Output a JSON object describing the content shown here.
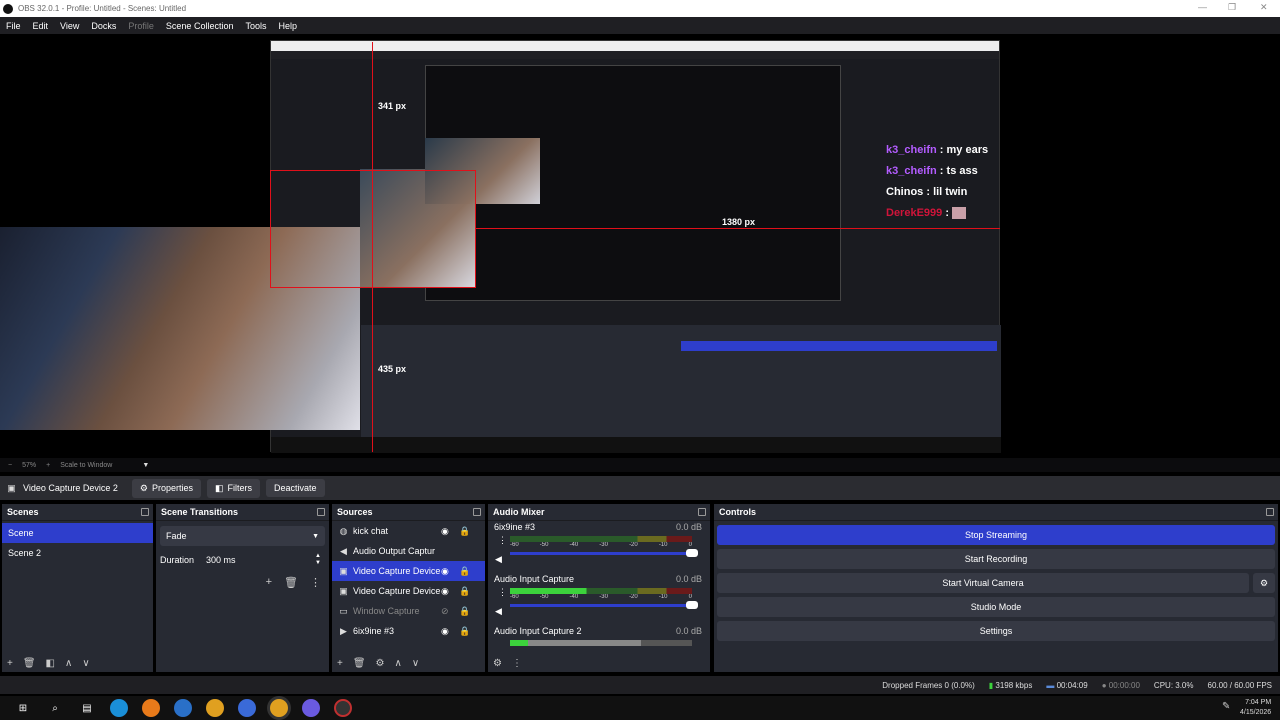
{
  "window": {
    "title": "OBS 32.0.1 - Profile: Untitled - Scenes: Untitled"
  },
  "menu": [
    "File",
    "Edit",
    "View",
    "Docks",
    "Profile",
    "Scene Collection",
    "Tools",
    "Help"
  ],
  "preview": {
    "measure_top": "341 px",
    "measure_right": "1380 px",
    "measure_bottom": "435 px",
    "chat": [
      {
        "user": "k3_cheifn",
        "message": "my ears",
        "color": "#b35cff"
      },
      {
        "user": "k3_cheifn",
        "message": "ts ass",
        "color": "#b35cff"
      },
      {
        "user": "Chinos",
        "message": "lil twin",
        "color": "#ffffff"
      },
      {
        "user": "DerekE999",
        "message": "",
        "color": "#d0143a"
      }
    ]
  },
  "zoom": {
    "percent": "57%",
    "mode": "Scale to Window"
  },
  "source_toolbar": {
    "selected_source": "Video Capture Device 2",
    "properties": "Properties",
    "filters": "Filters",
    "deactivate": "Deactivate"
  },
  "scenes": {
    "title": "Scenes",
    "items": [
      "Scene",
      "Scene 2"
    ]
  },
  "transitions": {
    "title": "Scene Transitions",
    "type": "Fade",
    "duration_label": "Duration",
    "duration_value": "300 ms"
  },
  "sources": {
    "title": "Sources",
    "items": [
      {
        "name": "kick chat",
        "icon": "globe-icon"
      },
      {
        "name": "Audio Output Captur",
        "icon": "speaker-icon"
      },
      {
        "name": "Video Capture Device",
        "icon": "camera-icon"
      },
      {
        "name": "Video Capture Device",
        "icon": "camera-icon"
      },
      {
        "name": "Window Capture",
        "icon": "window-icon"
      },
      {
        "name": "6ix9ine #3",
        "icon": "play-icon"
      }
    ]
  },
  "mixer": {
    "title": "Audio Mixer",
    "channels": [
      {
        "name": "6ix9ine #3",
        "db": "0.0 dB"
      },
      {
        "name": "Audio Input Capture",
        "db": "0.0 dB"
      },
      {
        "name": "Audio Input Capture 2",
        "db": "0.0 dB"
      }
    ],
    "scale": [
      "-60",
      "-55",
      "-50",
      "-45",
      "-40",
      "-35",
      "-30",
      "-25",
      "-20",
      "-15",
      "-10",
      "-5",
      "0"
    ]
  },
  "controls": {
    "title": "Controls",
    "stop_streaming": "Stop Streaming",
    "start_recording": "Start Recording",
    "start_virtual_camera": "Start Virtual Camera",
    "studio_mode": "Studio Mode",
    "settings": "Settings"
  },
  "status": {
    "dropped_frames": "Dropped Frames 0 (0.0%)",
    "bitrate": "3198 kbps",
    "stream_time": "00:04:09",
    "rec_time": "00:00:00",
    "cpu": "CPU: 3.0%",
    "fps": "60.00 / 60.00 FPS"
  },
  "clock": {
    "time": "7:04 PM",
    "date": "4/15/2026"
  },
  "colors": {
    "accent": "#2e3ecc",
    "panel": "#272a33",
    "guide_red": "#e0101a"
  }
}
